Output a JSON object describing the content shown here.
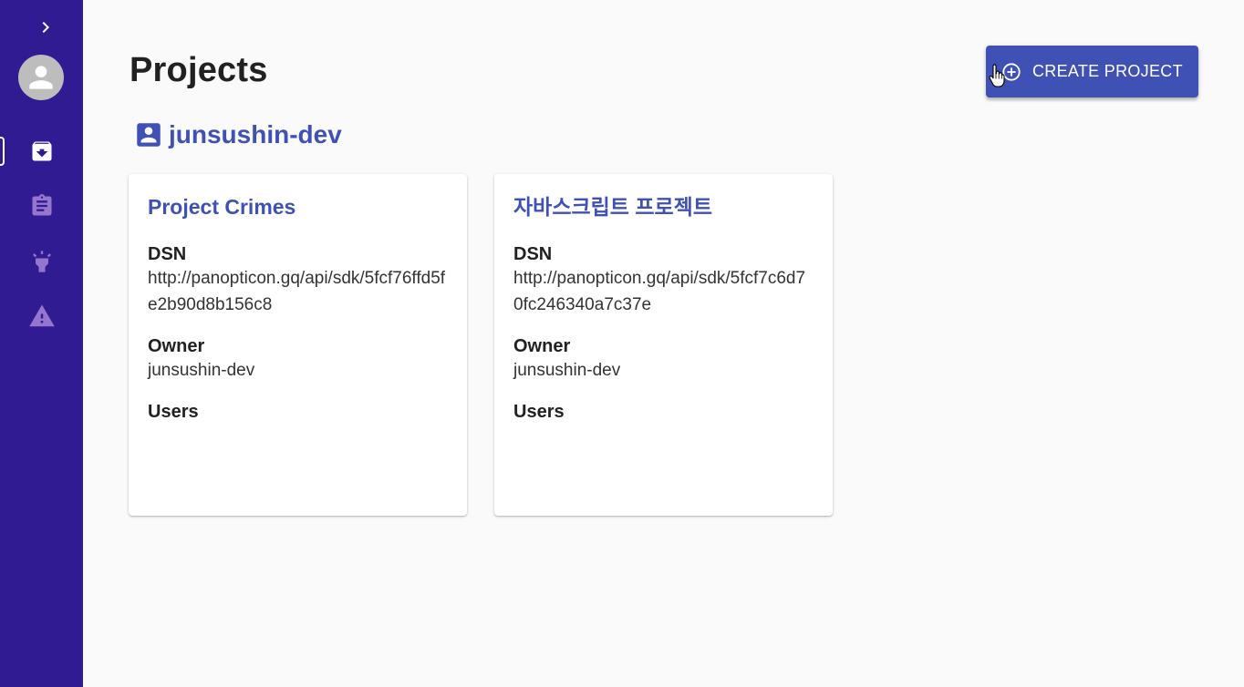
{
  "sidebar": {
    "toggle_icon": "chevron-right-icon",
    "avatar_icon": "person-icon",
    "items": [
      {
        "icon": "archive-icon",
        "active": true
      },
      {
        "icon": "assignment-icon",
        "active": false
      },
      {
        "icon": "highlight-icon",
        "active": false
      },
      {
        "icon": "warning-icon",
        "active": false
      }
    ]
  },
  "header": {
    "title": "Projects",
    "create_button_label": "CREATE PROJECT",
    "create_button_icon": "add-circle-outline-icon"
  },
  "owner_group": {
    "icon": "account-box-icon",
    "name": "junsushin-dev"
  },
  "projects": [
    {
      "title": "Project Crimes",
      "dsn_label": "DSN",
      "dsn": "http://panopticon.gq/api/sdk/5fcf76ffd5fe2b90d8b156c8",
      "owner_label": "Owner",
      "owner": "junsushin-dev",
      "users_label": "Users"
    },
    {
      "title": "자바스크립트 프로젝트",
      "dsn_label": "DSN",
      "dsn": "http://panopticon.gq/api/sdk/5fcf7c6d70fc246340a7c37e",
      "owner_label": "Owner",
      "owner": "junsushin-dev",
      "users_label": "Users"
    }
  ],
  "colors": {
    "sidebar_bg": "#311b92",
    "primary": "#3f51b5",
    "sidebar_icon": "#9575cd",
    "background": "#fafafa"
  }
}
